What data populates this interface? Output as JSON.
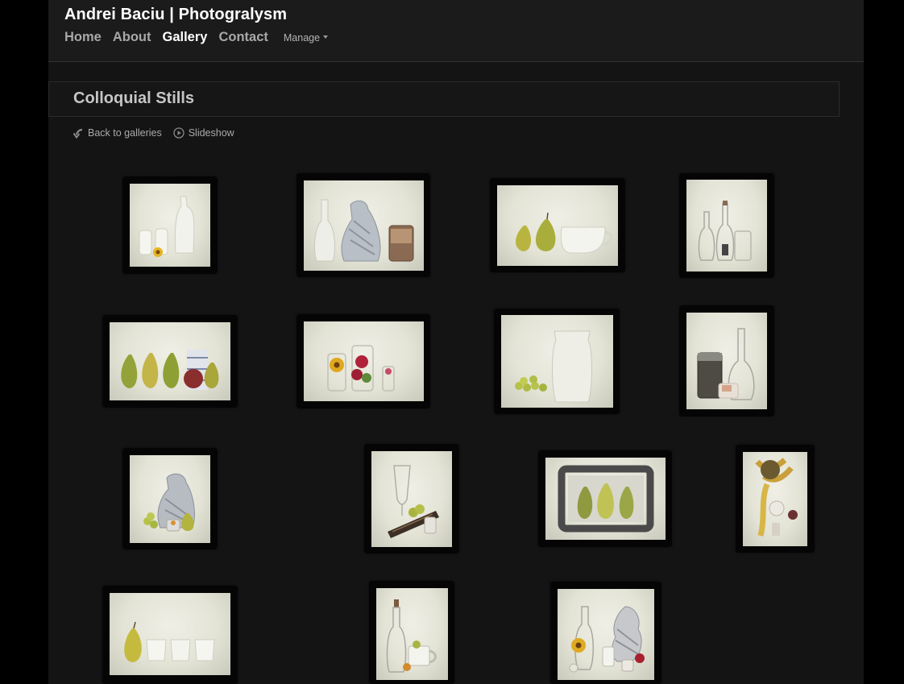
{
  "site": {
    "title": "Andrei Baciu | Photogralysm"
  },
  "nav": {
    "items": [
      {
        "label": "Home",
        "active": false
      },
      {
        "label": "About",
        "active": false
      },
      {
        "label": "Gallery",
        "active": true
      },
      {
        "label": "Contact",
        "active": false
      }
    ],
    "manage_label": "Manage"
  },
  "gallery": {
    "title": "Colloquial Stills",
    "back_label": "Back to galleries",
    "slideshow_label": "Slideshow"
  },
  "colors": {
    "page_bg": "#141414",
    "active_nav": "#ffffff",
    "inactive_nav": "#a8a8a8",
    "pear": "#b4b14a",
    "paper": "#e6e6da"
  },
  "icons": {
    "back": "back-arrow-icon",
    "slideshow": "play-circle-icon"
  }
}
